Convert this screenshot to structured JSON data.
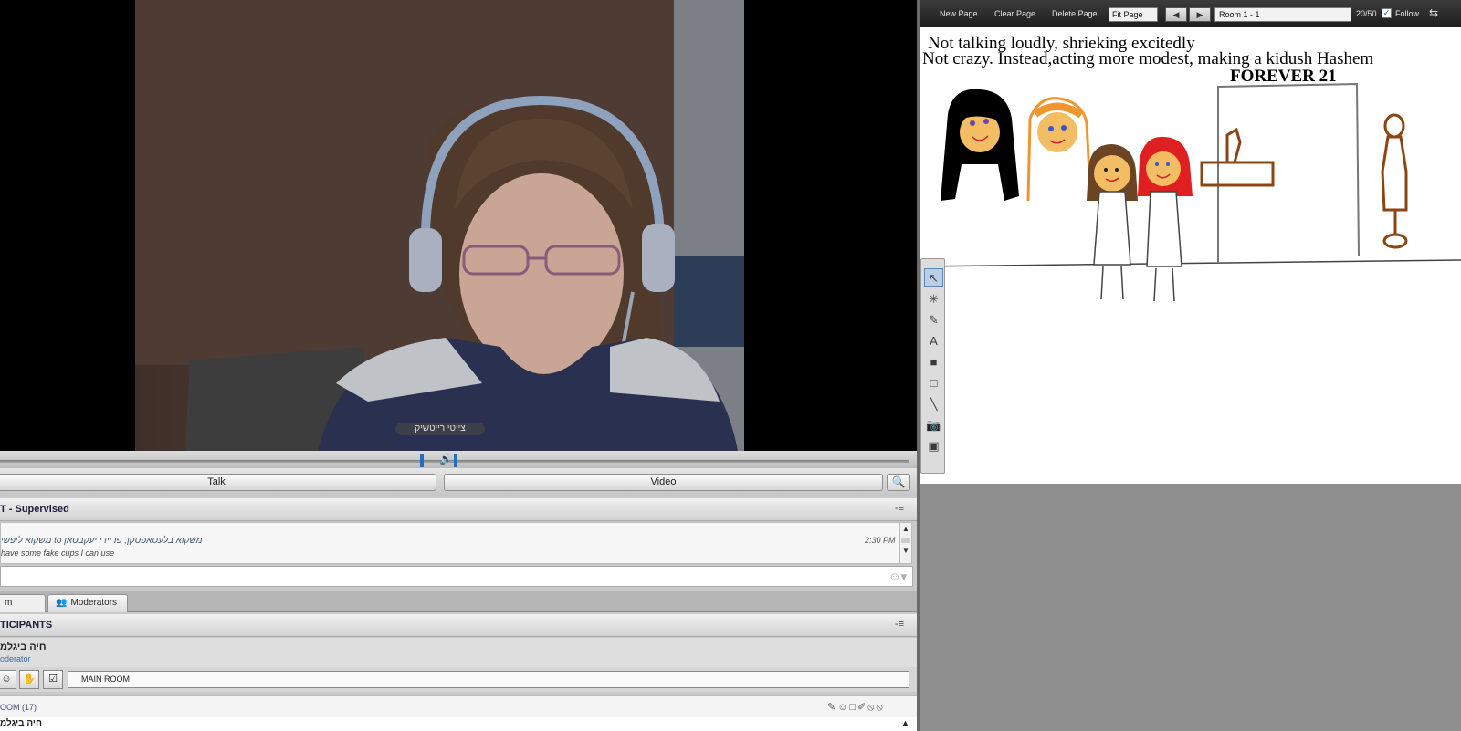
{
  "video": {
    "cam_name": "צייטי רייטשיק",
    "talk_label": "Talk",
    "video_label": "Video"
  },
  "chat": {
    "title": "T - Supervised",
    "message_line1": "משקוא בלעסאפסקן, פריידי יעקבסאן to משקוא ליפשי",
    "message_line2": "have some fake cups I can use",
    "message_time": "2:30 PM"
  },
  "tabs": {
    "room": "m",
    "moderators": "Moderators"
  },
  "participants": {
    "title": "TICIPANTS",
    "user_name": "חיה ביגלמ",
    "user_role": "oderator",
    "main_room": "MAIN ROOM",
    "room_count": "OOM (17)",
    "row_name": "חיה ביגלמ"
  },
  "whiteboard": {
    "new_page": "New Page",
    "clear_page": "Clear Page",
    "delete_page": "Delete Page",
    "fit_page": "Fit Page",
    "room_select": "Room 1 - 1",
    "page_count": "20/50",
    "follow": "Follow",
    "text_line1": "Not talking loudly, shrieking excitedly",
    "text_line2": "Not crazy. Instead,acting more modest, making a kidush Hashem",
    "store_sign": "FOREVER 21"
  },
  "colors": {
    "accent_blue": "#1f6fc2",
    "toolbar_dark": "#2b2b2b",
    "panel_gray": "#c9c9c9"
  },
  "icons": {
    "volume": "speaker-icon",
    "magnify": "magnify-icon",
    "emoji": "emoji-icon",
    "moderators": "user-icon",
    "sync": "sync-icon"
  }
}
